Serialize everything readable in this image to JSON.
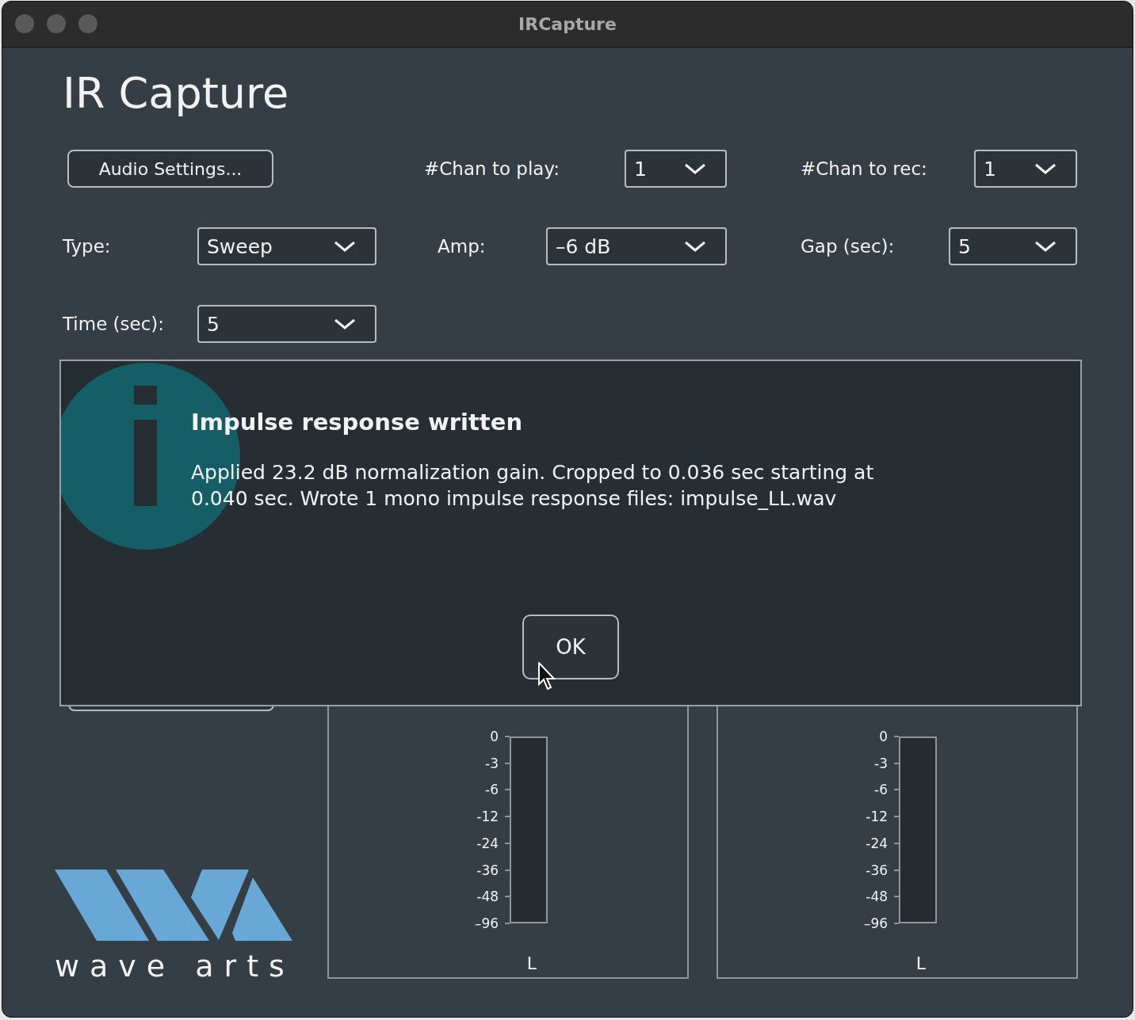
{
  "window": {
    "title": "IRCapture"
  },
  "heading": "IR Capture",
  "audio_settings_button": "Audio Settings...",
  "settings": [
    {
      "label": "#Chan to play:",
      "value": "1"
    },
    {
      "label": "#Chan to rec:",
      "value": "1"
    },
    {
      "label": "Type:",
      "value": "Sweep"
    },
    {
      "label": "Amp:",
      "value": "–6 dB"
    },
    {
      "label": "Gap (sec):",
      "value": "5"
    },
    {
      "label": "Time (sec):",
      "value": "5"
    }
  ],
  "dialog": {
    "title": "Impulse response written",
    "message": "Applied 23.2 dB normalization gain. Cropped to 0.036 sec starting at 0.040 sec. Wrote 1 mono impulse response files: impulse_LL.wav",
    "button": "OK"
  },
  "meters": [
    {
      "scale": [
        "0",
        "-3",
        "-6",
        "-12",
        "-24",
        "-36",
        "-48",
        "–96"
      ],
      "channel": "L",
      "level": 0
    },
    {
      "scale": [
        "0",
        "-3",
        "-6",
        "-12",
        "-24",
        "-36",
        "-48",
        "–96"
      ],
      "channel": "L",
      "level": 0
    }
  ],
  "logo": {
    "text": "wave arts"
  }
}
